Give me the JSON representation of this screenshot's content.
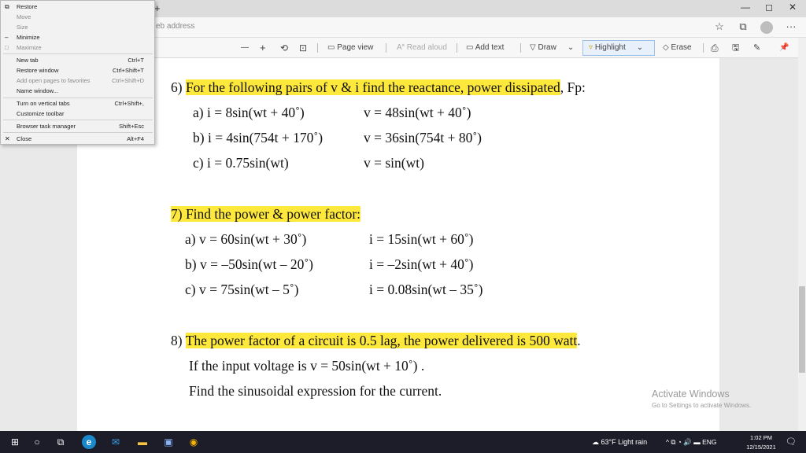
{
  "browser": {
    "new_tab_symbol": "+",
    "address_placeholder": "Search or enter web address",
    "minimize_symbol": "—",
    "restore_symbol": "◻",
    "close_symbol": "✕",
    "favorites_icon": "☆",
    "collections_icon": "⧉",
    "more_icon": "···"
  },
  "pdf_toolbar": {
    "zoom_out": "—",
    "zoom_in": "+",
    "rotate_icon": "⟲",
    "fit_icon": "⊡",
    "page_view": "Page view",
    "read_aloud": "Read aloud",
    "add_text": "Add text",
    "draw": "Draw",
    "highlight": "Highlight",
    "erase": "Erase",
    "print_icon": "⎙",
    "save_icon": "🖫",
    "save_as_icon": "✎",
    "pin_icon": "📌",
    "chevron": "⌄"
  },
  "context_menu": {
    "items": [
      {
        "label": "Restore",
        "key": "",
        "icon": "⧉",
        "disabled": false
      },
      {
        "label": "Move",
        "key": "",
        "icon": "",
        "disabled": true
      },
      {
        "label": "Size",
        "key": "",
        "icon": "",
        "disabled": true
      },
      {
        "label": "Minimize",
        "key": "",
        "icon": "–",
        "disabled": false
      },
      {
        "label": "Maximize",
        "key": "",
        "icon": "□",
        "disabled": true
      },
      {
        "label": "New tab",
        "key": "Ctrl+T",
        "icon": "",
        "disabled": false
      },
      {
        "label": "Restore window",
        "key": "Ctrl+Shift+T",
        "icon": "",
        "disabled": false
      },
      {
        "label": "Add open pages to favorites",
        "key": "Ctrl+Shift+D",
        "icon": "",
        "disabled": true
      },
      {
        "label": "Name window...",
        "key": "",
        "icon": "",
        "disabled": false
      },
      {
        "label": "Turn on vertical tabs",
        "key": "Ctrl+Shift+,",
        "icon": "",
        "disabled": false
      },
      {
        "label": "Customize toolbar",
        "key": "",
        "icon": "",
        "disabled": false
      },
      {
        "label": "Browser task manager",
        "key": "Shift+Esc",
        "icon": "",
        "disabled": false
      },
      {
        "label": "Close",
        "key": "Alt+F4",
        "icon": "✕",
        "disabled": false
      }
    ]
  },
  "document": {
    "q6_num": "6)",
    "q6_hl": "For the following pairs of v & i find the reactance, power dissipated",
    "q6_tail": ", Fp:",
    "q6a_i": "a) i = 8sin(wt + 40˚)",
    "q6a_v": "v = 48sin(wt + 40˚)",
    "q6b_i": "b) i = 4sin(754t + 170˚)",
    "q6b_v": "v = 36sin(754t + 80˚)",
    "q6c_i": "c) i = 0.75sin(wt)",
    "q6c_v": "v = sin(wt)",
    "q7_hl": "7) Find the power & power factor:",
    "q7a_v": "a) v = 60sin(wt + 30˚)",
    "q7a_i": "i = 15sin(wt + 60˚)",
    "q7b_v": "b) v = –50sin(wt – 20˚)",
    "q7b_i": "i = –2sin(wt + 40˚)",
    "q7c_v": "c) v = 75sin(wt – 5˚)",
    "q7c_i": "i = 0.08sin(wt – 35˚)",
    "q8_num": "8) ",
    "q8_hl": "The power factor of a circuit is 0.5 lag, the power delivered is 500 watt",
    "q8_tail": ".",
    "q8_line2": "If the input voltage is v = 50sin(wt + 10˚) .",
    "q8_line3": "Find the sinusoidal expression for the current."
  },
  "watermark": {
    "line1": "Activate Windows",
    "line2": "Go to Settings to activate Windows."
  },
  "taskbar": {
    "start_icon": "⊞",
    "search_icon": "○",
    "taskview_icon": "⧉",
    "edge_icon": "e",
    "mail_icon": "✉",
    "explorer_icon": "▬",
    "store_icon": "▣",
    "chrome_icon": "◉",
    "weather": "63°F  Light rain",
    "tray_icons": "^  ⧉  ◔  🔊  ▬",
    "lang": "ENG",
    "time": "1:02 PM",
    "date": "12/15/2021",
    "notif_icon": "🗨"
  },
  "colors": {
    "highlight": "#fde83b",
    "taskbar": "#1d1d2a"
  }
}
